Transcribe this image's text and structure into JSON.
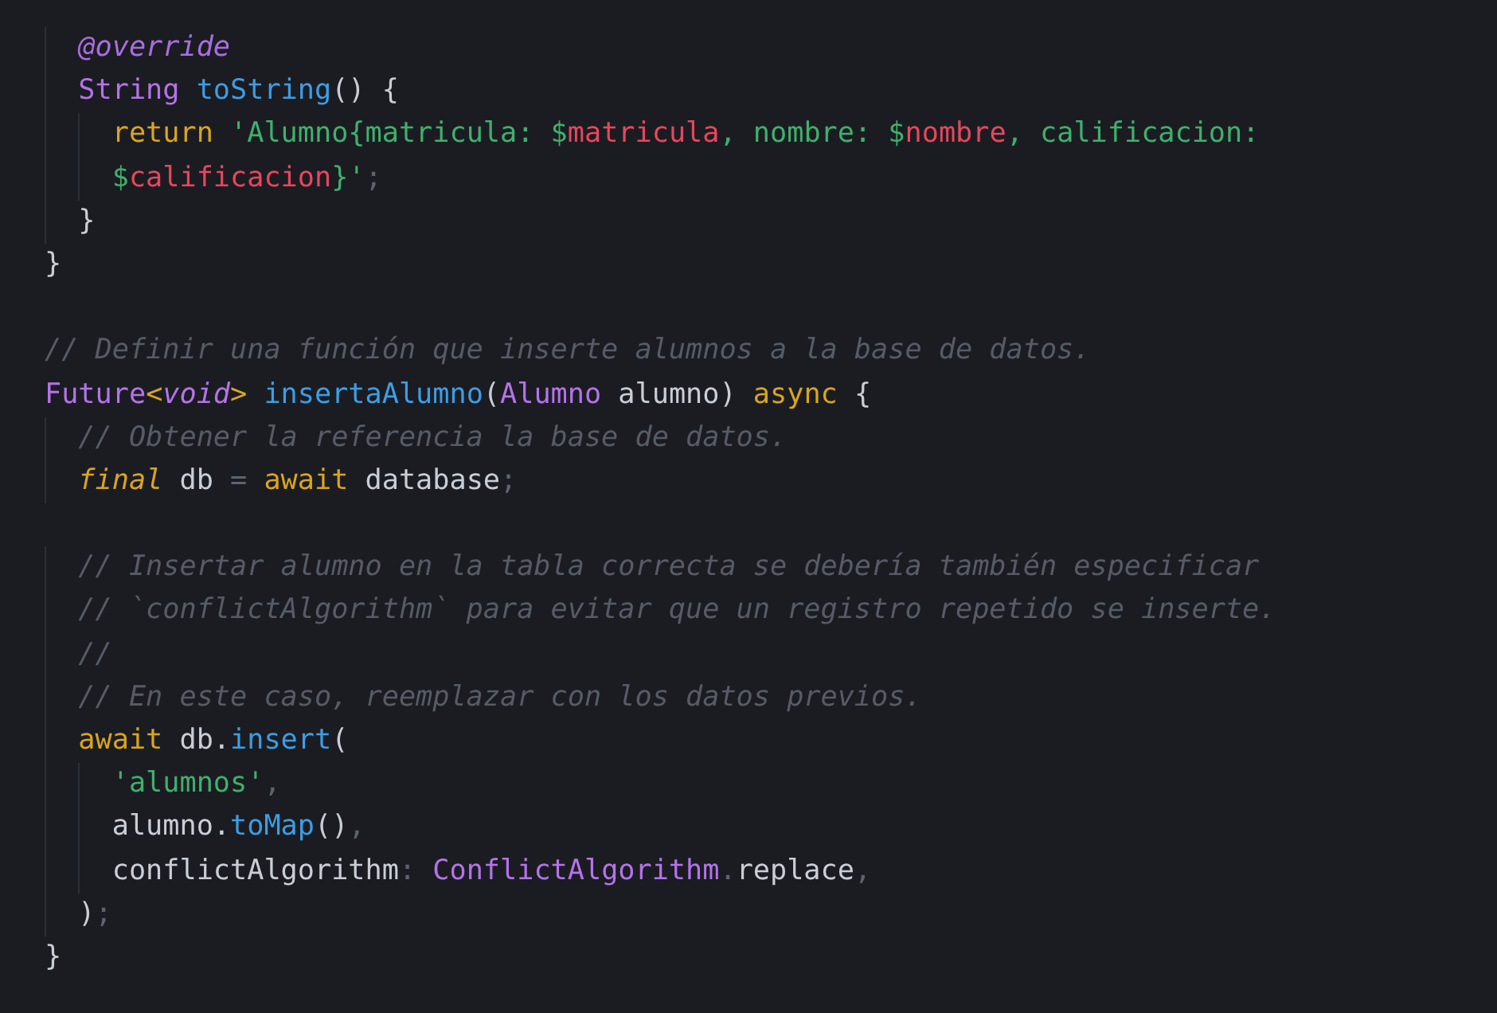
{
  "editor": {
    "lines": [
      {
        "kind": "code",
        "tokens": [
          {
            "kind": "annotation",
            "text": "  @override"
          }
        ]
      },
      {
        "kind": "code",
        "tokens": [
          {
            "kind": "type",
            "text": "  String"
          },
          {
            "kind": "fn",
            "text": " toString"
          },
          {
            "kind": "plain",
            "text": "() {"
          }
        ]
      },
      {
        "kind": "code",
        "tokens": [
          {
            "kind": "keyword",
            "text": "    return"
          },
          {
            "kind": "string",
            "text": " 'Alumno{matricula: $"
          },
          {
            "kind": "interp",
            "text": "matricula"
          },
          {
            "kind": "string",
            "text": ", nombre: $"
          },
          {
            "kind": "interp",
            "text": "nombre"
          },
          {
            "kind": "string",
            "text": ", calificacion:"
          }
        ]
      },
      {
        "kind": "code",
        "tokens": [
          {
            "kind": "string",
            "text": "    $"
          },
          {
            "kind": "interp",
            "text": "calificacion"
          },
          {
            "kind": "string",
            "text": "}'"
          },
          {
            "kind": "punct",
            "text": ";"
          }
        ]
      },
      {
        "kind": "code",
        "tokens": [
          {
            "kind": "plain",
            "text": "  }"
          }
        ]
      },
      {
        "kind": "code",
        "tokens": [
          {
            "kind": "plain",
            "text": "}"
          }
        ]
      },
      {
        "kind": "blank"
      },
      {
        "kind": "code",
        "tokens": [
          {
            "kind": "comment",
            "text": "// Definir una función que inserte alumnos a la base de datos."
          }
        ]
      },
      {
        "kind": "code",
        "tokens": [
          {
            "kind": "type",
            "text": "Future"
          },
          {
            "kind": "bracket",
            "text": "<"
          },
          {
            "kind": "type-italic",
            "text": "void"
          },
          {
            "kind": "bracket",
            "text": ">"
          },
          {
            "kind": "fn",
            "text": " insertaAlumno"
          },
          {
            "kind": "plain",
            "text": "("
          },
          {
            "kind": "type",
            "text": "Alumno"
          },
          {
            "kind": "plain",
            "text": " alumno) "
          },
          {
            "kind": "keyword",
            "text": "async"
          },
          {
            "kind": "plain",
            "text": " {"
          }
        ]
      },
      {
        "kind": "code",
        "tokens": [
          {
            "kind": "comment",
            "text": "  // Obtener la referencia la base de datos."
          }
        ]
      },
      {
        "kind": "code",
        "tokens": [
          {
            "kind": "keyword-italic",
            "text": "  final"
          },
          {
            "kind": "plain",
            "text": " db "
          },
          {
            "kind": "punct",
            "text": "="
          },
          {
            "kind": "keyword",
            "text": " await"
          },
          {
            "kind": "plain",
            "text": " database"
          },
          {
            "kind": "punct",
            "text": ";"
          }
        ]
      },
      {
        "kind": "blank"
      },
      {
        "kind": "code",
        "tokens": [
          {
            "kind": "comment",
            "text": "  // Insertar alumno en la tabla correcta se debería también especificar"
          }
        ]
      },
      {
        "kind": "code",
        "tokens": [
          {
            "kind": "comment",
            "text": "  // `conflictAlgorithm` para evitar que un registro repetido se inserte."
          }
        ]
      },
      {
        "kind": "code",
        "tokens": [
          {
            "kind": "comment",
            "text": "  //"
          }
        ]
      },
      {
        "kind": "code",
        "tokens": [
          {
            "kind": "comment",
            "text": "  // En este caso, reemplazar con los datos previos."
          }
        ]
      },
      {
        "kind": "code",
        "tokens": [
          {
            "kind": "keyword",
            "text": "  await"
          },
          {
            "kind": "plain",
            "text": " db."
          },
          {
            "kind": "fn",
            "text": "insert"
          },
          {
            "kind": "plain",
            "text": "("
          }
        ]
      },
      {
        "kind": "code",
        "tokens": [
          {
            "kind": "string",
            "text": "    'alumnos'"
          },
          {
            "kind": "punct",
            "text": ","
          }
        ]
      },
      {
        "kind": "code",
        "tokens": [
          {
            "kind": "plain",
            "text": "    alumno."
          },
          {
            "kind": "fn",
            "text": "toMap"
          },
          {
            "kind": "plain",
            "text": "()"
          },
          {
            "kind": "punct",
            "text": ","
          }
        ]
      },
      {
        "kind": "code",
        "tokens": [
          {
            "kind": "plain",
            "text": "    conflictAlgorithm"
          },
          {
            "kind": "punct",
            "text": ":"
          },
          {
            "kind": "type",
            "text": " ConflictAlgorithm"
          },
          {
            "kind": "punct",
            "text": "."
          },
          {
            "kind": "plain",
            "text": "replace"
          },
          {
            "kind": "punct",
            "text": ","
          }
        ]
      },
      {
        "kind": "code",
        "tokens": [
          {
            "kind": "plain",
            "text": "  )"
          },
          {
            "kind": "punct",
            "text": ";"
          }
        ]
      },
      {
        "kind": "code",
        "tokens": [
          {
            "kind": "plain",
            "text": "}"
          }
        ]
      }
    ]
  }
}
